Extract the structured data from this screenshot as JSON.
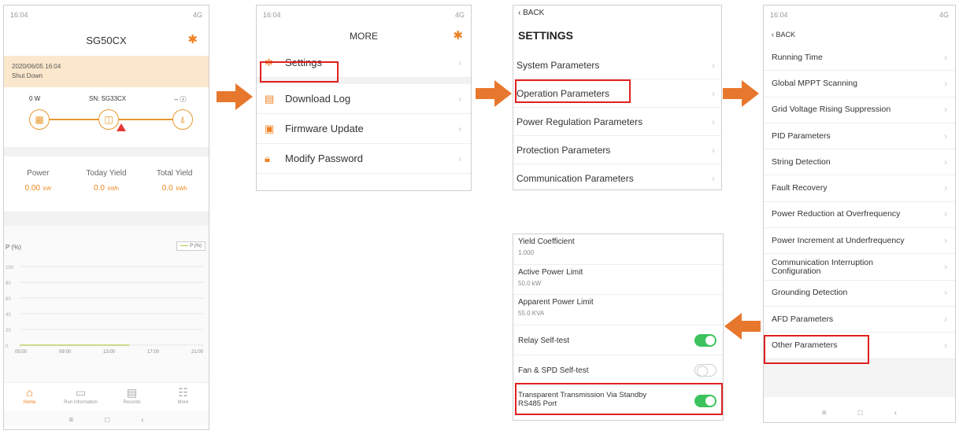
{
  "screen1": {
    "status_time": "16:04",
    "status_icons": "4G",
    "title": "SG50CX",
    "timestamp": "2020/06/05 16:04",
    "state": "Shut Down",
    "pv_power": "0 W",
    "sn": "SN: SG33CX",
    "grid_label": "-- ⓘ",
    "kpis": [
      {
        "label": "Power",
        "value": "0.00",
        "unit": "kW"
      },
      {
        "label": "Today Yield",
        "value": "0.0",
        "unit": "kWh"
      },
      {
        "label": "Total Yield",
        "value": "0.0",
        "unit": "kWh"
      }
    ],
    "legend": "P (%)",
    "ylabel": "P (%)",
    "chart_data": {
      "type": "line",
      "ylabel": "P (%)",
      "yticks": [
        "100",
        "80",
        "60",
        "40",
        "20",
        "0"
      ],
      "ylim": [
        0,
        100
      ],
      "categories": [
        "05:00",
        "09:00",
        "13:00",
        "17:00",
        "21:00"
      ],
      "series": [
        {
          "name": "P (%)",
          "values": [
            0,
            0,
            0,
            0
          ],
          "color": "#b2c84a"
        }
      ]
    },
    "tabs": [
      {
        "label": "Home",
        "icon": "home-icon",
        "active": true
      },
      {
        "label": "Run Information",
        "icon": "monitor-icon",
        "active": false
      },
      {
        "label": "Records",
        "icon": "clipboard-icon",
        "active": false
      },
      {
        "label": "More",
        "icon": "grid-icon",
        "active": false
      }
    ]
  },
  "screen2": {
    "status_time": "16:04",
    "status_icons": "4G",
    "title": "MORE",
    "items": [
      {
        "label": "Settings",
        "icon": "gear-icon"
      },
      {
        "label": "Download Log",
        "icon": "log-icon"
      },
      {
        "label": "Firmware Update",
        "icon": "firmware-icon"
      },
      {
        "label": "Modify Password",
        "icon": "lock-icon"
      }
    ]
  },
  "screen3": {
    "back": "BACK",
    "title": "SETTINGS",
    "items": [
      "System Parameters",
      "Operation Parameters",
      "Power Regulation Parameters",
      "Protection Parameters",
      "Communication Parameters"
    ]
  },
  "screen4": {
    "status_time": "16:04",
    "status_icons": "4G",
    "back": "BACK",
    "items": [
      "Running Time",
      "Global MPPT Scanning",
      "Grid Voltage Rising Suppression",
      "PID Parameters",
      "String Detection",
      "Fault Recovery",
      "Power Reduction at Overfrequency",
      "Power Increment at Underfrequency",
      "Communication Interruption Configuration",
      "Grounding Detection",
      "AFD Parameters",
      "Other Parameters"
    ]
  },
  "screen5": {
    "values": [
      {
        "label": "Yield Coefficient",
        "value": "1.000"
      },
      {
        "label": "Active Power Limit",
        "value": "50.0 kW"
      },
      {
        "label": "Apparent Power Limit",
        "value": "55.0 KVA"
      }
    ],
    "toggles": [
      {
        "label": "Relay Self-test",
        "on": true
      },
      {
        "label": "Fan & SPD Self-test",
        "on": false
      },
      {
        "label": "Transparent Transmission Via Standby RS485 Port",
        "on": true
      }
    ]
  },
  "colors": {
    "accent": "#f08020",
    "highlight": "#e02020",
    "toggle_on": "#3cc35e",
    "arrow": "#e8772e"
  }
}
